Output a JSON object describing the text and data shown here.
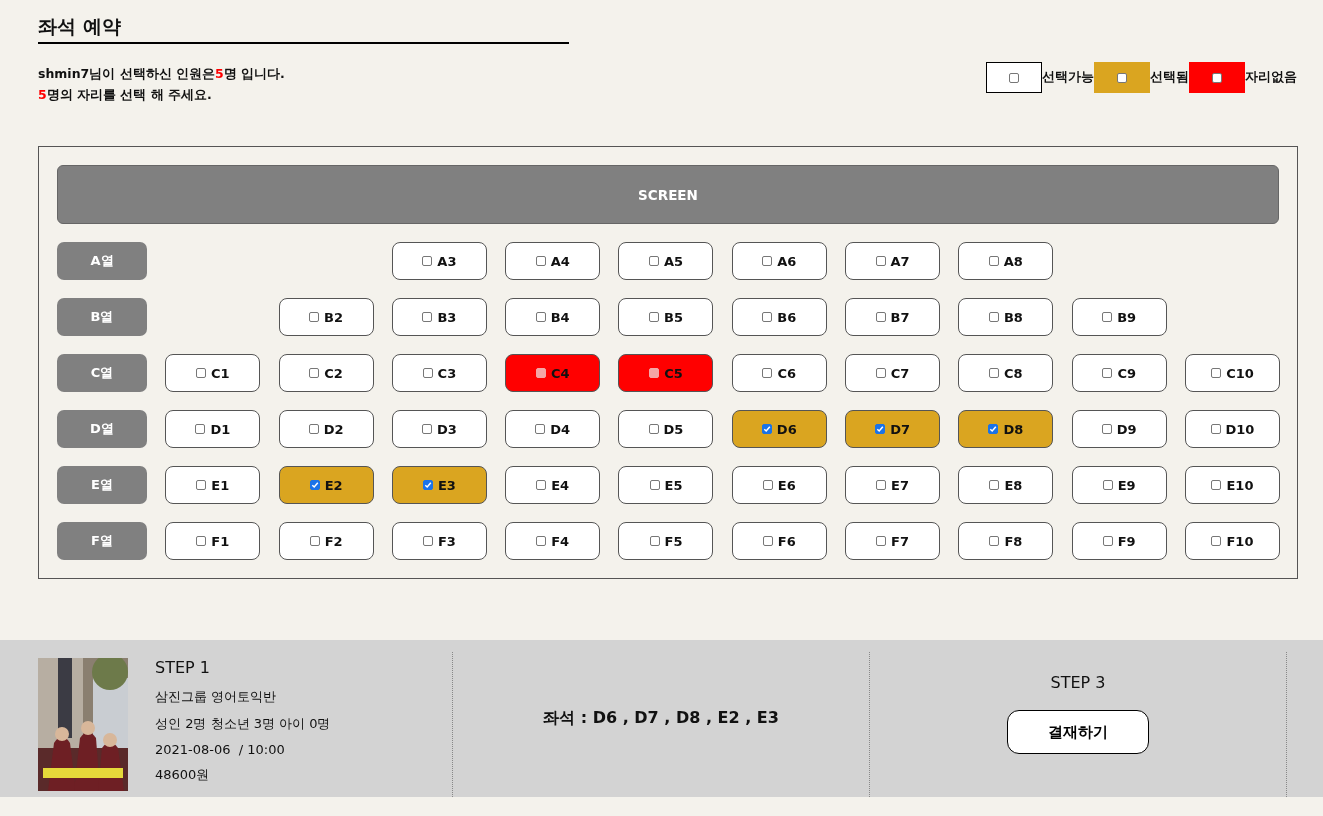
{
  "title": "좌석 예약",
  "intro": [
    [
      {
        "text": "shmin7님이 선택하신 인원은",
        "highlight": false
      },
      {
        "text": "5",
        "highlight": true
      },
      {
        "text": "명 입니다.",
        "highlight": false
      }
    ],
    [
      {
        "text": "5",
        "highlight": true
      },
      {
        "text": "명의 자리를 선택 해 주세요.",
        "highlight": false
      }
    ]
  ],
  "legend": [
    {
      "kind": "available",
      "label": "선택가능"
    },
    {
      "kind": "selected",
      "label": "선택됨"
    },
    {
      "kind": "unavailable",
      "label": "자리없음"
    }
  ],
  "screen": "SCREEN",
  "rows": [
    {
      "label": "A열",
      "seats": [
        {
          "kind": "gap"
        },
        {
          "kind": "gap"
        },
        {
          "kind": "seat",
          "label": "A3",
          "selected": false,
          "disabled": false
        },
        {
          "kind": "seat",
          "label": "A4",
          "selected": false,
          "disabled": false
        },
        {
          "kind": "seat",
          "label": "A5",
          "selected": false,
          "disabled": false
        },
        {
          "kind": "seat",
          "label": "A6",
          "selected": false,
          "disabled": false
        },
        {
          "kind": "seat",
          "label": "A7",
          "selected": false,
          "disabled": false
        },
        {
          "kind": "seat",
          "label": "A8",
          "selected": false,
          "disabled": false
        }
      ]
    },
    {
      "label": "B열",
      "seats": [
        {
          "kind": "gap"
        },
        {
          "kind": "seat",
          "label": "B2",
          "selected": false,
          "disabled": false
        },
        {
          "kind": "seat",
          "label": "B3",
          "selected": false,
          "disabled": false
        },
        {
          "kind": "seat",
          "label": "B4",
          "selected": false,
          "disabled": false
        },
        {
          "kind": "seat",
          "label": "B5",
          "selected": false,
          "disabled": false
        },
        {
          "kind": "seat",
          "label": "B6",
          "selected": false,
          "disabled": false
        },
        {
          "kind": "seat",
          "label": "B7",
          "selected": false,
          "disabled": false
        },
        {
          "kind": "seat",
          "label": "B8",
          "selected": false,
          "disabled": false
        },
        {
          "kind": "seat",
          "label": "B9",
          "selected": false,
          "disabled": false
        }
      ]
    },
    {
      "label": "C열",
      "seats": [
        {
          "kind": "seat",
          "label": "C1",
          "selected": false,
          "disabled": false
        },
        {
          "kind": "seat",
          "label": "C2",
          "selected": false,
          "disabled": false
        },
        {
          "kind": "seat",
          "label": "C3",
          "selected": false,
          "disabled": false
        },
        {
          "kind": "seat",
          "label": "C4",
          "selected": false,
          "disabled": true
        },
        {
          "kind": "seat",
          "label": "C5",
          "selected": false,
          "disabled": true
        },
        {
          "kind": "seat",
          "label": "C6",
          "selected": false,
          "disabled": false
        },
        {
          "kind": "seat",
          "label": "C7",
          "selected": false,
          "disabled": false
        },
        {
          "kind": "seat",
          "label": "C8",
          "selected": false,
          "disabled": false
        },
        {
          "kind": "seat",
          "label": "C9",
          "selected": false,
          "disabled": false
        },
        {
          "kind": "seat",
          "label": "C10",
          "selected": false,
          "disabled": false
        }
      ]
    },
    {
      "label": "D열",
      "seats": [
        {
          "kind": "seat",
          "label": "D1",
          "selected": false,
          "disabled": false
        },
        {
          "kind": "seat",
          "label": "D2",
          "selected": false,
          "disabled": false
        },
        {
          "kind": "seat",
          "label": "D3",
          "selected": false,
          "disabled": false
        },
        {
          "kind": "seat",
          "label": "D4",
          "selected": false,
          "disabled": false
        },
        {
          "kind": "seat",
          "label": "D5",
          "selected": false,
          "disabled": false
        },
        {
          "kind": "seat",
          "label": "D6",
          "selected": true,
          "disabled": false
        },
        {
          "kind": "seat",
          "label": "D7",
          "selected": true,
          "disabled": false
        },
        {
          "kind": "seat",
          "label": "D8",
          "selected": true,
          "disabled": false
        },
        {
          "kind": "seat",
          "label": "D9",
          "selected": false,
          "disabled": false
        },
        {
          "kind": "seat",
          "label": "D10",
          "selected": false,
          "disabled": false
        }
      ]
    },
    {
      "label": "E열",
      "seats": [
        {
          "kind": "seat",
          "label": "E1",
          "selected": false,
          "disabled": false
        },
        {
          "kind": "seat",
          "label": "E2",
          "selected": true,
          "disabled": false
        },
        {
          "kind": "seat",
          "label": "E3",
          "selected": true,
          "disabled": false
        },
        {
          "kind": "seat",
          "label": "E4",
          "selected": false,
          "disabled": false
        },
        {
          "kind": "seat",
          "label": "E5",
          "selected": false,
          "disabled": false
        },
        {
          "kind": "seat",
          "label": "E6",
          "selected": false,
          "disabled": false
        },
        {
          "kind": "seat",
          "label": "E7",
          "selected": false,
          "disabled": false
        },
        {
          "kind": "seat",
          "label": "E8",
          "selected": false,
          "disabled": false
        },
        {
          "kind": "seat",
          "label": "E9",
          "selected": false,
          "disabled": false
        },
        {
          "kind": "seat",
          "label": "E10",
          "selected": false,
          "disabled": false
        }
      ]
    },
    {
      "label": "F열",
      "seats": [
        {
          "kind": "seat",
          "label": "F1",
          "selected": false,
          "disabled": false
        },
        {
          "kind": "seat",
          "label": "F2",
          "selected": false,
          "disabled": false
        },
        {
          "kind": "seat",
          "label": "F3",
          "selected": false,
          "disabled": false
        },
        {
          "kind": "seat",
          "label": "F4",
          "selected": false,
          "disabled": false
        },
        {
          "kind": "seat",
          "label": "F5",
          "selected": false,
          "disabled": false
        },
        {
          "kind": "seat",
          "label": "F6",
          "selected": false,
          "disabled": false
        },
        {
          "kind": "seat",
          "label": "F7",
          "selected": false,
          "disabled": false
        },
        {
          "kind": "seat",
          "label": "F8",
          "selected": false,
          "disabled": false
        },
        {
          "kind": "seat",
          "label": "F9",
          "selected": false,
          "disabled": false
        },
        {
          "kind": "seat",
          "label": "F10",
          "selected": false,
          "disabled": false
        }
      ]
    }
  ],
  "summary": {
    "step1": "STEP 1",
    "movie": "삼진그룹 영어토익반",
    "people": "성인 2명 청소년 3명 아이 0명",
    "datetime": "2021-08-06  / 10:00",
    "price": "48600원",
    "seats": "좌석 : D6 , D7 , D8 , E2 , E3",
    "step3": "STEP 3",
    "pay_button": "결재하기"
  }
}
